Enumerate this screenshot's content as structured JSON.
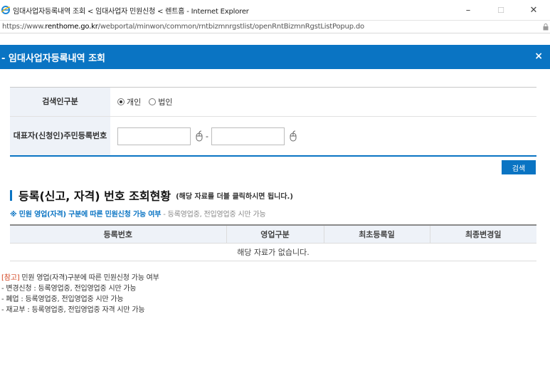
{
  "window": {
    "title": "임대사업자등록내역 조회 < 임대사업자 민원신청 < 렌트홈 - Internet Explorer",
    "minimize": "–",
    "maximize": "☐",
    "close": "✕"
  },
  "address_bar": {
    "url_prefix": "https://www.",
    "url_domain": "renthome.go.kr",
    "url_path": "/webportal/minwon/common/rntbizmnrgstlist/openRntBizmnRgstListPopup.do"
  },
  "popup": {
    "title": "- 임대사업자등록내역 조회",
    "close": "×"
  },
  "search_form": {
    "type_label": "검색인구분",
    "type_options": [
      {
        "label": "개인",
        "selected": true
      },
      {
        "label": "법인",
        "selected": false
      }
    ],
    "ssn_label_line1": "대표자(신청인)",
    "ssn_label_line2": "주민등록번호",
    "ssn_separator": "-",
    "ssn_first_value": "",
    "ssn_second_value": ""
  },
  "search_button": "검색",
  "section": {
    "title": "등록(신고, 자격) 번호 조회현황",
    "note": "(해당 자료를 더블 클릭하시면 됩니다.)"
  },
  "notice": {
    "main": "※ 민원 영업(자격) 구분에 따른 민원신청 가능 여부",
    "sub": " - 등록영업중, 전입영업중 시만 가능"
  },
  "results_table": {
    "columns": [
      "등록번호",
      "영업구분",
      "최초등록일",
      "최종변경일"
    ],
    "empty_message": "해당 자료가 없습니다."
  },
  "reference": {
    "tag": "[참고]",
    "heading": " 민원 영업(자격)구분에 따른 민원신청 가능 여부",
    "lines": [
      "- 변경신청 : 등록영업중, 전입영업중 시만 가능",
      "- 폐업 : 등록영업중, 전입영업중 시만 가능",
      "- 재교부 : 등록영업중, 전입영업중 자격 시만 가능"
    ]
  },
  "colors": {
    "accent": "#0a74c3",
    "label_bg": "#eef2f8",
    "reference_tag": "#d2411c"
  }
}
